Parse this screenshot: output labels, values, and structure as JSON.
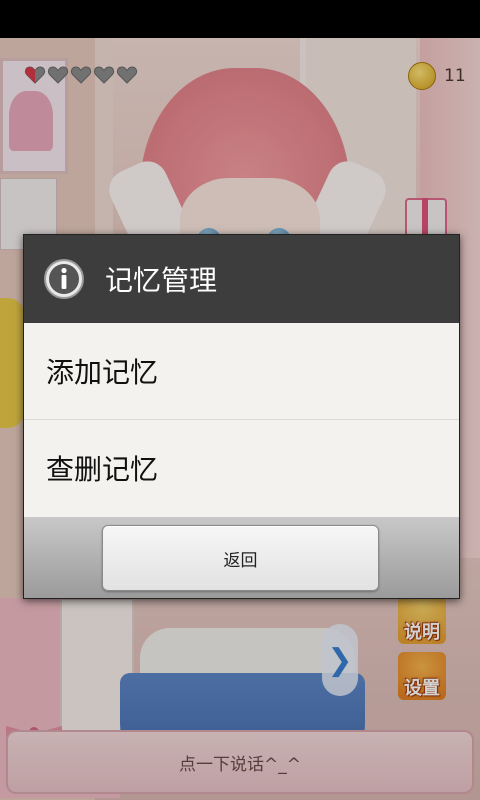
{
  "hud": {
    "hearts": {
      "filled": 0.5,
      "total": 5
    },
    "coins": "11"
  },
  "side_buttons": {
    "help_label": "说明",
    "settings_label": "设置"
  },
  "talk_bar": {
    "label": "点一下说话^_^"
  },
  "dialog": {
    "title": "记忆管理",
    "items": [
      {
        "label": "添加记忆"
      },
      {
        "label": "查删记忆"
      }
    ],
    "back_label": "返回"
  },
  "colors": {
    "dialog_header": "#3d3d3d",
    "dialog_body": "#f3f2ee",
    "heart_red": "#d8394a",
    "heart_gray": "#8a8a8a"
  },
  "icons": {
    "dialog_icon": "info-icon",
    "next": "chevron-right-icon"
  }
}
